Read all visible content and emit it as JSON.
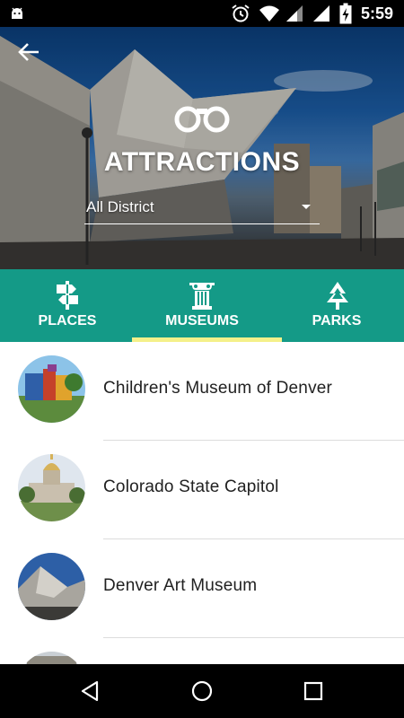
{
  "status_bar": {
    "time": "5:59",
    "icons": [
      "android-icon",
      "alarm-icon",
      "wifi-icon",
      "signal-icon",
      "signal-icon",
      "battery-charging-icon"
    ]
  },
  "header": {
    "back_icon": "arrow-left-icon",
    "logo_icon": "binoculars-icon",
    "title": "ATTRACTIONS",
    "district_select": {
      "selected": "All District"
    }
  },
  "tabs": [
    {
      "label": "PLACES",
      "icon": "signpost-icon",
      "selected": false
    },
    {
      "label": "MUSEUMS",
      "icon": "museum-column-icon",
      "selected": true
    },
    {
      "label": "PARKS",
      "icon": "tree-icon",
      "selected": false
    }
  ],
  "list_items": [
    {
      "title": "Children's Museum of Denver"
    },
    {
      "title": "Colorado State Capitol"
    },
    {
      "title": "Denver Art Museum"
    },
    {
      "title": ""
    }
  ],
  "nav_bar": {
    "icons": [
      "back-triangle-icon",
      "home-circle-icon",
      "recents-square-icon"
    ]
  },
  "colors": {
    "tab_bar": "#149a87",
    "tab_indicator": "#f4f08a",
    "status_bar": "#000000"
  }
}
